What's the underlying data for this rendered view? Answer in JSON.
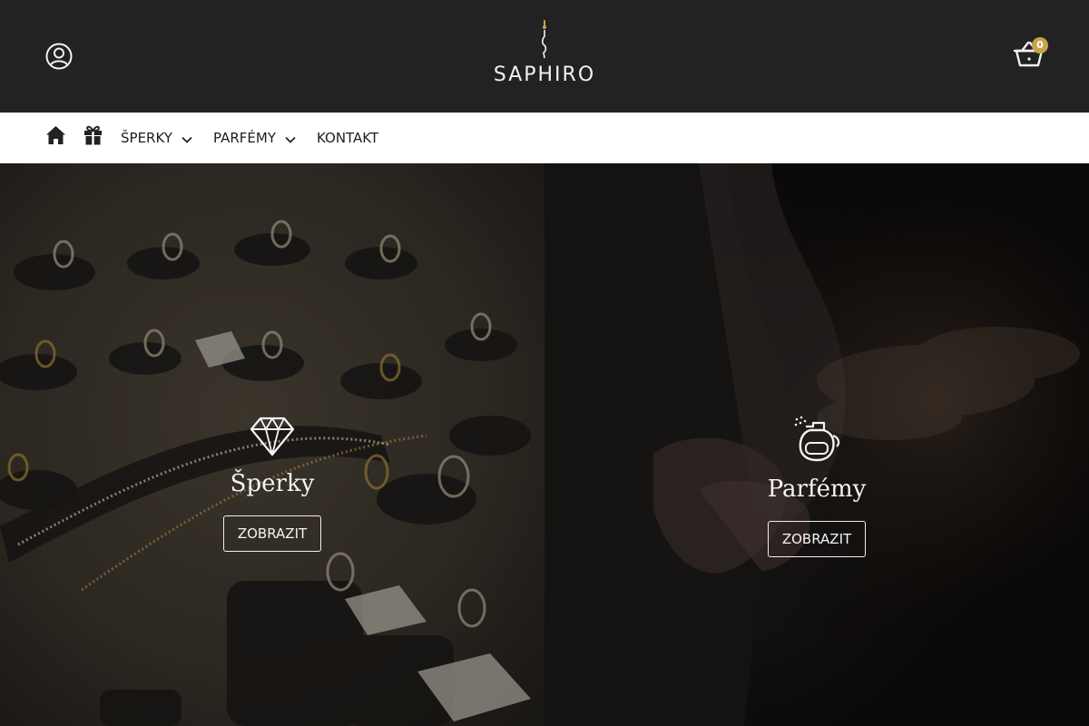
{
  "header": {
    "account_icon": "user-circle-icon",
    "logo": {
      "text": "SAPHIRO",
      "icon": "jewel-drop-logo-icon"
    },
    "cart": {
      "icon": "basket-icon",
      "count": "0",
      "badge_color": "#c9a347"
    }
  },
  "nav": {
    "home_icon": "home-icon",
    "gift_icon": "gift-icon",
    "items": [
      {
        "label": "ŠPERKY",
        "dropdown": true
      },
      {
        "label": "PARFÉMY",
        "dropdown": true
      },
      {
        "label": "KONTAKT",
        "dropdown": false
      }
    ]
  },
  "panels": [
    {
      "title": "Šperky",
      "button": "ZOBRAZIT",
      "icon": "diamond-icon"
    },
    {
      "title": "Parfémy",
      "button": "ZOBRAZIT",
      "icon": "perfume-bottle-icon"
    }
  ],
  "colors": {
    "header_bg": "#232223",
    "nav_bg": "#ffffff",
    "accent": "#c9a347"
  }
}
